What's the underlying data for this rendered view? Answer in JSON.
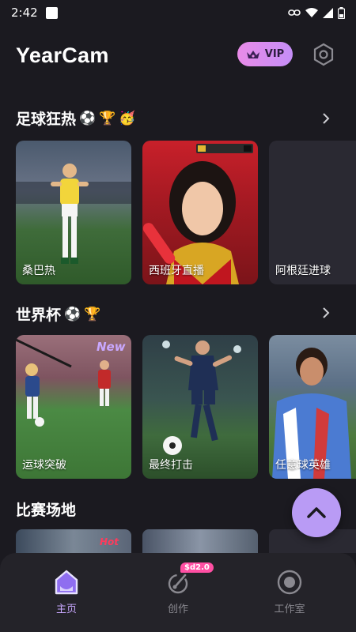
{
  "status": {
    "time": "2:42"
  },
  "header": {
    "title": "YearCam",
    "vip_label": "VIP"
  },
  "sections": [
    {
      "title": "足球狂热",
      "emojis": [
        "⚽",
        "🏆",
        "🥳"
      ],
      "cards": [
        {
          "label": "桑巴热"
        },
        {
          "label": "西班牙直播"
        },
        {
          "label": "阿根廷进球"
        }
      ]
    },
    {
      "title": "世界杯",
      "emojis": [
        "⚽",
        "🏆"
      ],
      "cards": [
        {
          "label": "运球突破",
          "badge": "New"
        },
        {
          "label": "最终打击"
        },
        {
          "label": "任意球英雄"
        }
      ]
    },
    {
      "title": "比赛场地",
      "thumb_badge": "Hot"
    }
  ],
  "bottom_nav": {
    "items": [
      {
        "label": "主页",
        "icon": "home-icon",
        "active": true
      },
      {
        "label": "创作",
        "icon": "create-icon",
        "badge": "$d2.0"
      },
      {
        "label": "工作室",
        "icon": "studio-icon"
      }
    ]
  },
  "colors": {
    "background": "#1b1a20",
    "accent": "#b99bf5",
    "vip_gradient_start": "#e98be8",
    "vip_gradient_end": "#c58ef7",
    "nav_active": "#c9a8ff"
  }
}
